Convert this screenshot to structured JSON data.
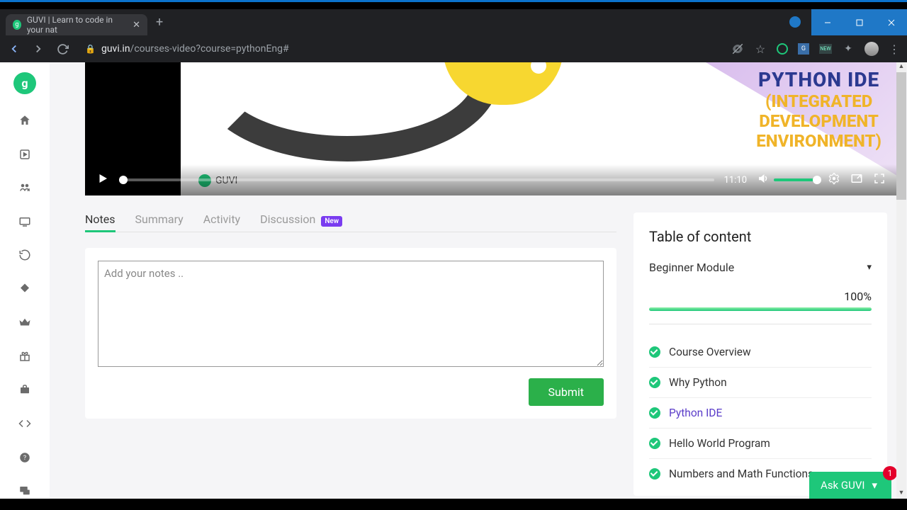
{
  "browser": {
    "tab_title": "GUVI | Learn to code in your nat",
    "url_host": "guvi.in",
    "url_path": "/courses-video?course=pythonEng#"
  },
  "video": {
    "title_line1": "PYTHON IDE",
    "title_line2": "(INTEGRATED",
    "title_line3": "DEVELOPMENT",
    "title_line4": "ENVIRONMENT)",
    "watermark": "GUVI",
    "time": "11:10"
  },
  "tabs": {
    "notes": "Notes",
    "summary": "Summary",
    "activity": "Activity",
    "discussion": "Discussion",
    "new_badge": "New"
  },
  "notes": {
    "placeholder": "Add your notes ..",
    "submit": "Submit"
  },
  "toc": {
    "title": "Table of content",
    "module": "Beginner Module",
    "percent": "100%",
    "lessons": [
      "Course Overview",
      "Why Python",
      "Python IDE",
      "Hello World Program",
      "Numbers and Math Functions"
    ],
    "active_index": 2
  },
  "ask": {
    "label": "Ask GUVI",
    "count": "1"
  }
}
